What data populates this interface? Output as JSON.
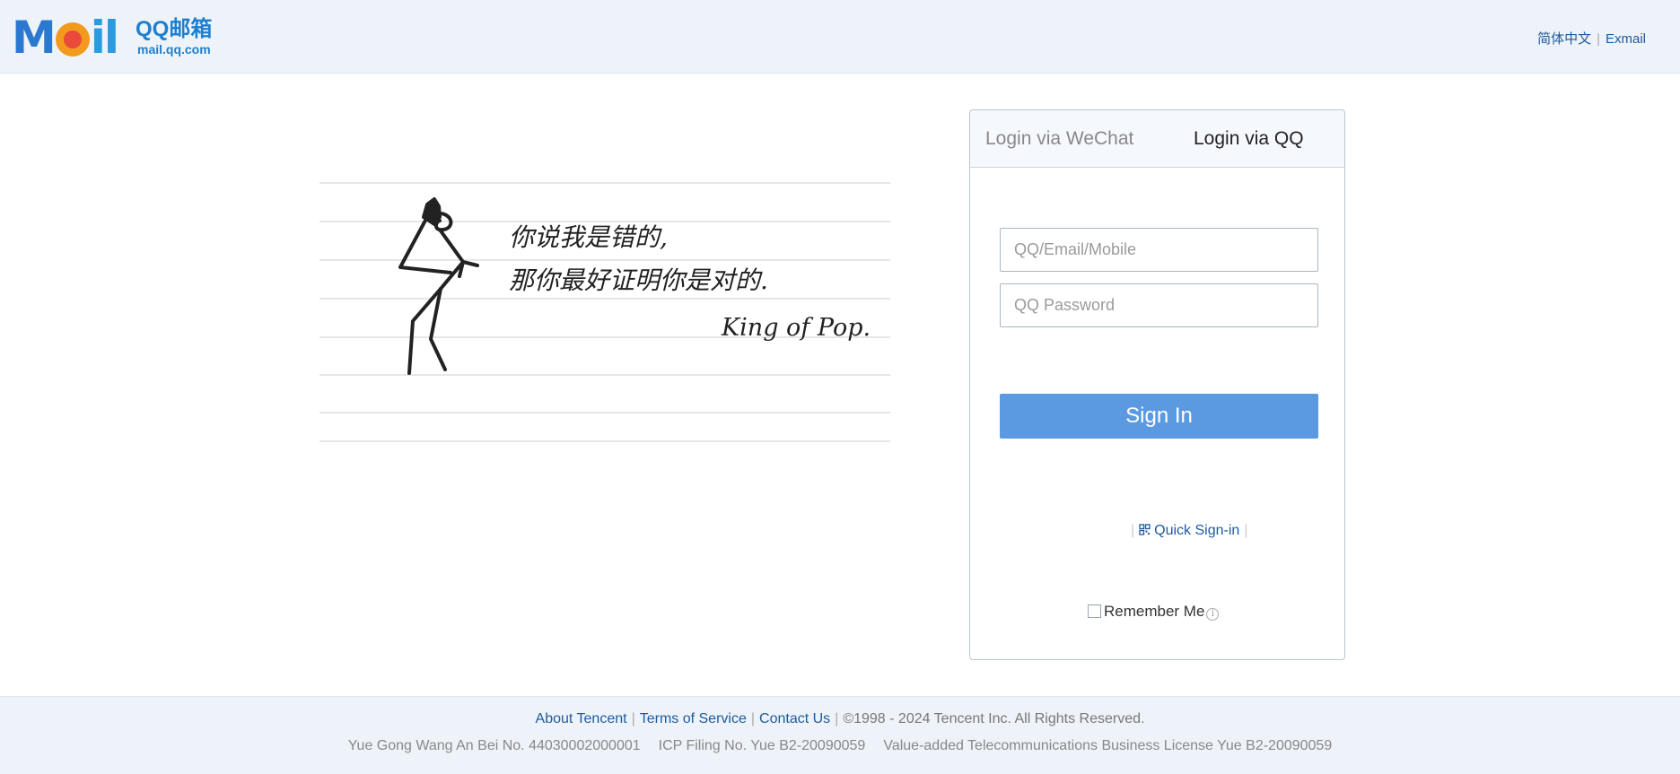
{
  "header": {
    "logo": {
      "mark": "Mail",
      "name_cn": "QQ邮箱",
      "domain": "mail.qq.com"
    },
    "links": [
      "简体中文",
      "Exmail"
    ]
  },
  "illustration": {
    "lines": [
      "你说我是错的,",
      "那你最好证明你是对的."
    ],
    "signature": "King of Pop."
  },
  "login": {
    "tabs": [
      "Login via WeChat",
      "Login via QQ"
    ],
    "active_tab": "Login via QQ",
    "username_placeholder": "QQ/Email/Mobile",
    "password_placeholder": "QQ Password",
    "signin_label": "Sign In",
    "quick_signin_label": "Quick Sign-in",
    "remember_label": "Remember Me",
    "remember_checked": false,
    "accent_color": "#5b9ae0"
  },
  "footer": {
    "links": [
      "About Tencent",
      "Terms of Service",
      "Contact Us"
    ],
    "copyright": "©1998 - 2024 Tencent Inc. All Rights Reserved.",
    "registrations": [
      "Yue Gong Wang An Bei No. 44030002000001",
      "ICP Filing No. Yue B2-20090059",
      "Value-added Telecommunications Business License Yue B2-20090059"
    ]
  }
}
